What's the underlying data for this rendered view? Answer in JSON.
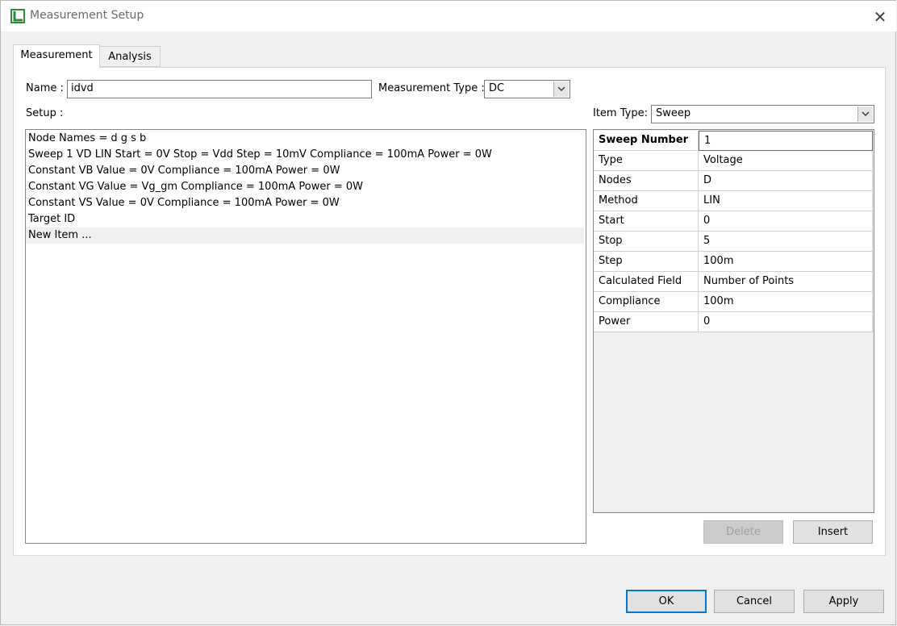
{
  "window": {
    "title": "Measurement Setup",
    "app_icon": "L-logo-icon",
    "close_icon": "close-icon",
    "close_glyph": "✕"
  },
  "tabs": [
    {
      "label": "Measurement",
      "active": true
    },
    {
      "label": "Analysis",
      "active": false
    }
  ],
  "form": {
    "name_label": "Name :",
    "name_value": "idvd",
    "type_label": "Measurement Type :",
    "type_value": "DC",
    "setup_label": "Setup :",
    "item_type_label": "Item Type:",
    "item_type_value": "Sweep"
  },
  "setup_items": [
    "Node Names = d g s b",
    "Sweep 1 VD LIN Start = 0V Stop = Vdd Step = 10mV Compliance = 100mA Power = 0W",
    "Constant VB Value = 0V Compliance = 100mA Power = 0W",
    "Constant VG Value = Vg_gm Compliance = 100mA Power = 0W",
    "Constant VS Value = 0V Compliance = 100mA Power = 0W",
    "Target ID",
    "New Item ..."
  ],
  "selected_item": "New Item ...",
  "properties": [
    {
      "key": "Sweep Number",
      "value": "1"
    },
    {
      "key": "Type",
      "value": "Voltage"
    },
    {
      "key": "Nodes",
      "value": "D"
    },
    {
      "key": "Method",
      "value": "LIN"
    },
    {
      "key": "Start",
      "value": "0"
    },
    {
      "key": "Stop",
      "value": "5"
    },
    {
      "key": "Step",
      "value": "100m"
    },
    {
      "key": "Calculated Field",
      "value": "Number of Points"
    },
    {
      "key": "Compliance",
      "value": "100m"
    },
    {
      "key": "Power",
      "value": "0"
    }
  ],
  "buttons": {
    "delete": "Delete",
    "insert": "Insert",
    "ok": "OK",
    "cancel": "Cancel",
    "apply": "Apply"
  },
  "colors": {
    "focus_border": "#0078d7",
    "icon_green": "#2e8b3a"
  }
}
